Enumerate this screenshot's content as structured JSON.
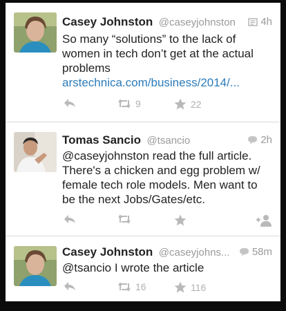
{
  "tweets": [
    {
      "name": "Casey Johnston",
      "handle": "@caseyjohnston",
      "time": "4h",
      "meta_icon": "conversation-icon",
      "text": "So many “solutions” to the lack of women in tech don’t get at the actual problems ",
      "link": "arstechnica.com/business/2014/...",
      "retweets": "9",
      "favorites": "22"
    },
    {
      "name": "Tomas Sancio",
      "handle": "@tsancio",
      "time": "2h",
      "meta_icon": "reply-bubble-icon",
      "text": "@caseyjohnston read the full article. There's a chicken and egg problem w/ female tech role models. Men want to be the next Jobs/Gates/etc.",
      "retweets": "",
      "favorites": ""
    },
    {
      "name": "Casey Johnston",
      "handle": "@caseyjohns...",
      "time": "58m",
      "meta_icon": "reply-bubble-icon",
      "text": "@tsancio I wrote the article",
      "retweets": "16",
      "favorites": "116"
    }
  ],
  "colors": {
    "link": "#2b7bb9",
    "icon_gray": "#b0b0b0",
    "meta_gray": "#9a9a9a"
  }
}
